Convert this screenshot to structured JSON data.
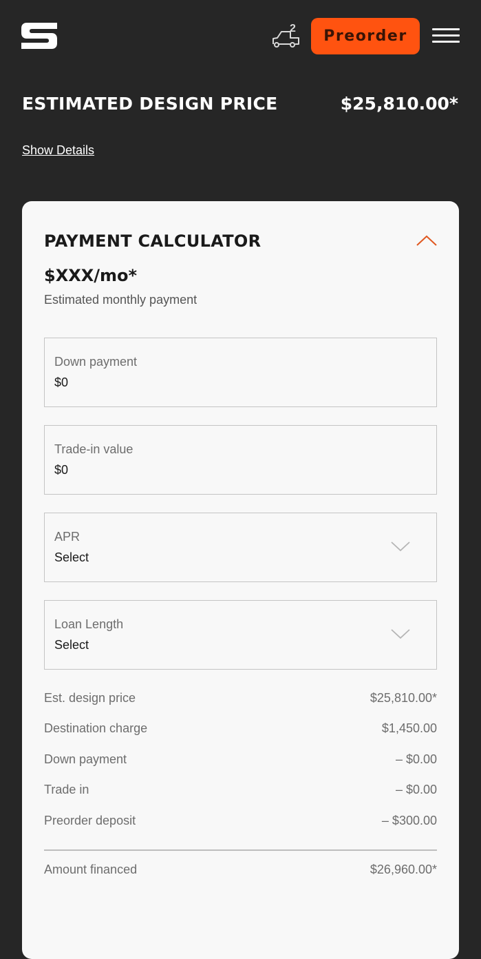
{
  "header": {
    "garage_count": "2",
    "preorder_label": "Preorder"
  },
  "price": {
    "title": "ESTIMATED DESIGN PRICE",
    "value": "$25,810.00*",
    "show_details": "Show Details"
  },
  "calculator": {
    "title": "PAYMENT CALCULATOR",
    "monthly_value": "$XXX/mo*",
    "monthly_label": "Estimated monthly payment",
    "fields": [
      {
        "label": "Down payment",
        "value": "$0"
      },
      {
        "label": "Trade-in value",
        "value": "$0"
      },
      {
        "label": "APR",
        "value": "Select"
      },
      {
        "label": "Loan Length",
        "value": "Select"
      }
    ],
    "summary": [
      {
        "label": "Est. design price",
        "value": "$25,810.00*"
      },
      {
        "label": "Destination charge",
        "value": "$1,450.00"
      },
      {
        "label": "Down payment",
        "value": "– $0.00"
      },
      {
        "label": "Trade in",
        "value": "– $0.00"
      },
      {
        "label": "Preorder deposit",
        "value": "– $300.00"
      }
    ],
    "amount_financed": {
      "label": "Amount financed",
      "value": "$26,960.00*"
    }
  },
  "colors": {
    "background": "#262626",
    "accent": "#ff5310",
    "card": "#f8f8f8"
  }
}
